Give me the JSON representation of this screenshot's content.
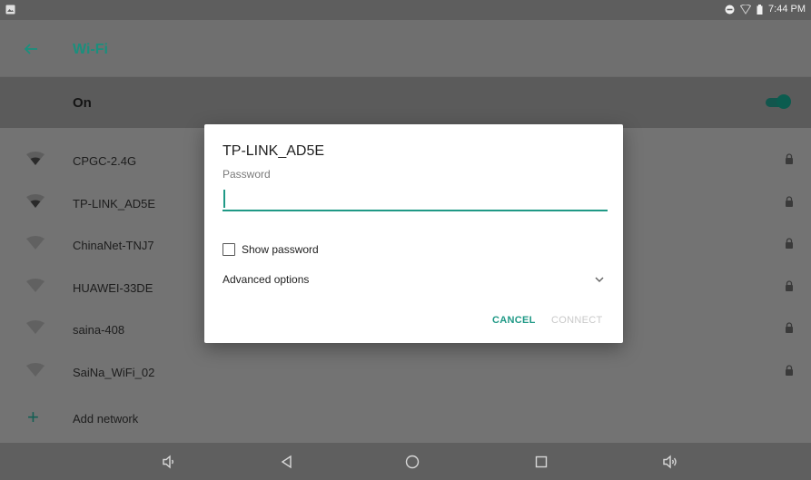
{
  "status_bar": {
    "time": "7:44 PM"
  },
  "toolbar": {
    "title": "Wi-Fi"
  },
  "toggle_row": {
    "label": "On",
    "enabled": true
  },
  "networks": [
    {
      "name": "CPGC-2.4G"
    },
    {
      "name": "TP-LINK_AD5E"
    },
    {
      "name": "ChinaNet-TNJ7"
    },
    {
      "name": "HUAWEI-33DE"
    },
    {
      "name": "saina-408"
    },
    {
      "name": "SaiNa_WiFi_02"
    }
  ],
  "add_network": {
    "label": "Add network"
  },
  "dialog": {
    "title": "TP-LINK_AD5E",
    "password_label": "Password",
    "password_value": "",
    "show_password_label": "Show password",
    "show_password_checked": false,
    "advanced_label": "Advanced options",
    "cancel_label": "CANCEL",
    "connect_label": "CONNECT"
  },
  "colors": {
    "accent": "#1f9986",
    "dim_background": "#737373",
    "dialog_background": "#ffffff"
  },
  "icons": {
    "status_left": "image-icon",
    "status_right": [
      "do-not-disturb-icon",
      "wifi-signal-icon",
      "battery-icon"
    ],
    "toolbar": "back-arrow-icon",
    "network": "wifi-signal-icon",
    "secure": "lock-icon",
    "add": "plus-icon",
    "advanced": "chevron-down-icon",
    "nav": [
      "volume-down-icon",
      "back-triangle-icon",
      "home-circle-icon",
      "recents-square-icon",
      "volume-up-icon"
    ]
  }
}
